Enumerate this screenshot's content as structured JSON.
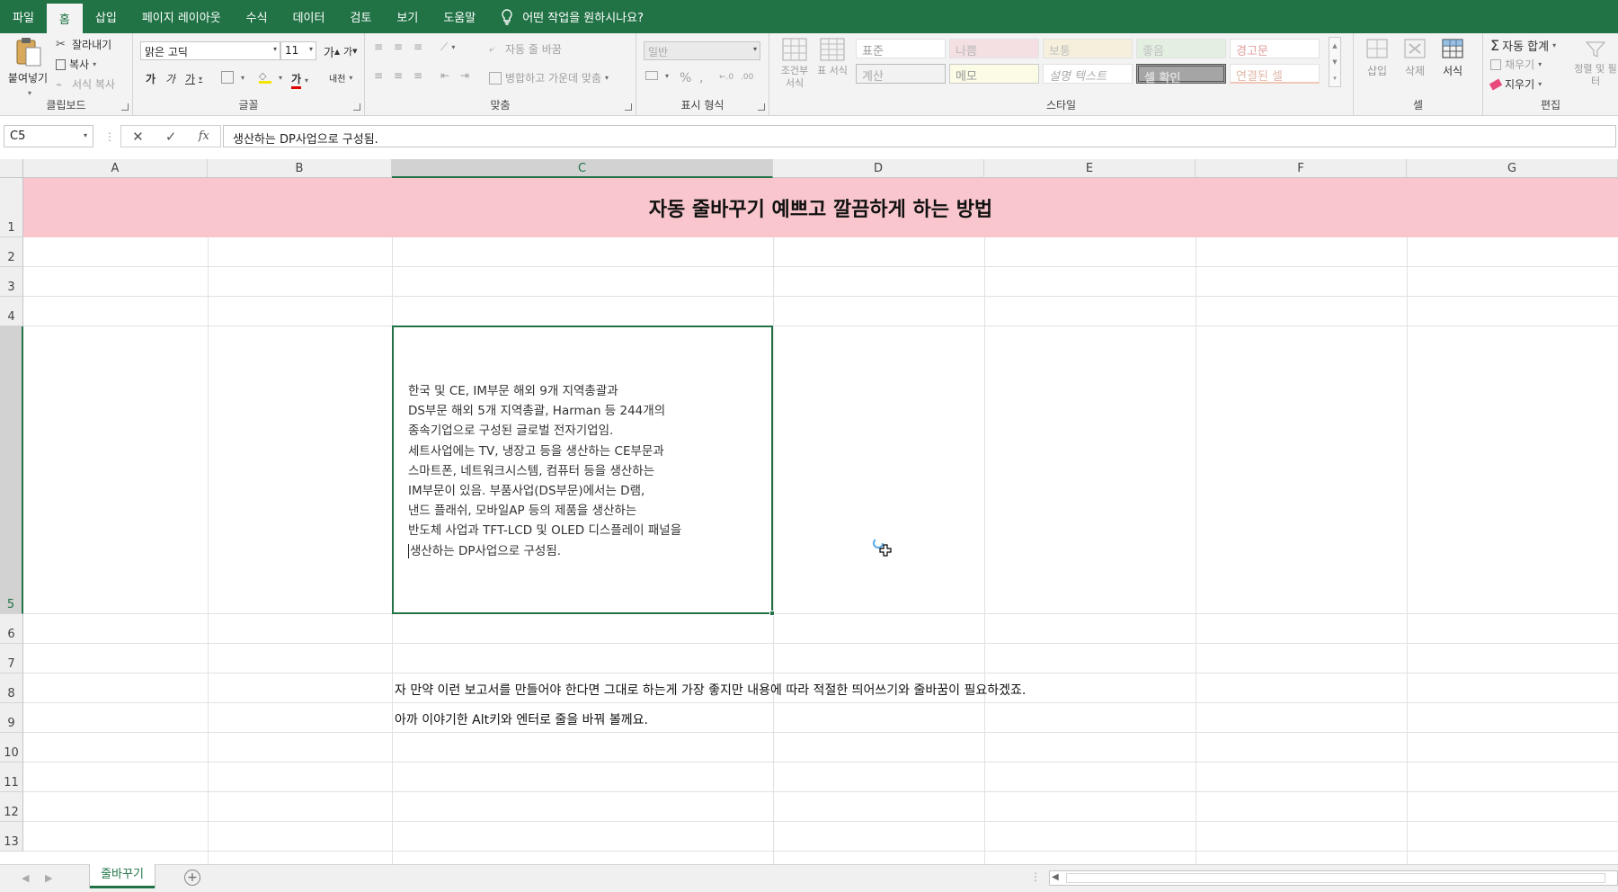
{
  "menu": {
    "tabs": [
      "파일",
      "홈",
      "삽입",
      "페이지 레이아웃",
      "수식",
      "데이터",
      "검토",
      "보기",
      "도움말"
    ],
    "active": "홈",
    "tell_me": "어떤 작업을 원하시나요?"
  },
  "ribbon": {
    "clipboard": {
      "paste": "붙여넣기",
      "cut": "잘라내기",
      "copy": "복사",
      "format_painter": "서식 복사",
      "label": "클립보드"
    },
    "font": {
      "name": "맑은 고딕",
      "size": "11",
      "bold": "가",
      "italic": "가",
      "underline": "가",
      "color_letter": "가",
      "phonetic": "내천",
      "grow": "가",
      "shrink": "가",
      "label": "글꼴"
    },
    "alignment": {
      "wrap": "자동 줄 바꿈",
      "merge": "병합하고 가운데 맞춤",
      "label": "맞춤"
    },
    "number": {
      "format": "일반",
      "percent": "%",
      "comma": ",",
      "label": "표시 형식"
    },
    "styles": {
      "cond_format": "조건부 서식",
      "table_format": "표 서식",
      "cells": [
        "표준",
        "나쁨",
        "보통",
        "좋음",
        "경고문",
        "계산",
        "메모",
        "설명 텍스트",
        "셀 확인",
        "연결된 셀"
      ],
      "label": "스타일"
    },
    "cells_group": {
      "insert": "삽입",
      "delete": "삭제",
      "format": "서식",
      "label": "셀"
    },
    "editing": {
      "autosum": "자동 합계",
      "fill": "채우기",
      "clear": "지우기",
      "sort_filter": "정렬 및 필터",
      "label": "편집"
    }
  },
  "formula_bar": {
    "name_box": "C5",
    "content": "생산하는 DP사업으로 구성됨."
  },
  "sheet": {
    "columns": [
      "A",
      "B",
      "C",
      "D",
      "E",
      "F",
      "G"
    ],
    "selected_column": "C",
    "rows": [
      "1",
      "2",
      "3",
      "4",
      "5",
      "6",
      "7",
      "8",
      "9",
      "10",
      "11",
      "12",
      "13"
    ],
    "selected_row": "5",
    "title": "자동 줄바꾸기 예쁘고 깔끔하게 하는 방법",
    "c5_lines": [
      "한국 및 CE, IM부문 해외 9개 지역총괄과",
      "DS부문 해외 5개 지역총괄, Harman 등 244개의",
      "종속기업으로 구성된 글로벌 전자기업임.",
      "세트사업에는 TV, 냉장고 등을 생산하는 CE부문과",
      "스마트폰, 네트워크시스템, 컴퓨터 등을 생산하는",
      "IM부문이 있음. 부품사업(DS부문)에서는 D램,",
      "낸드 플래쉬, 모바일AP 등의 제품을 생산하는",
      "반도체 사업과 TFT-LCD 및 OLED 디스플레이 패널을",
      "생산하는 DP사업으로 구성됨."
    ],
    "c8": "자 만약 이런 보고서를 만들어야 한다면 그대로 하는게 가장 좋지만 내용에 따라 적절한 띄어쓰기와 줄바꿈이 필요하겠죠.",
    "c9": "아까 이야기한 Alt키와 엔터로 줄을 바꿔 볼께요."
  },
  "sheet_tabs": {
    "active": "줄바꾸기"
  },
  "colors": {
    "accent": "#217346",
    "title_band": "#f8c6cc"
  }
}
